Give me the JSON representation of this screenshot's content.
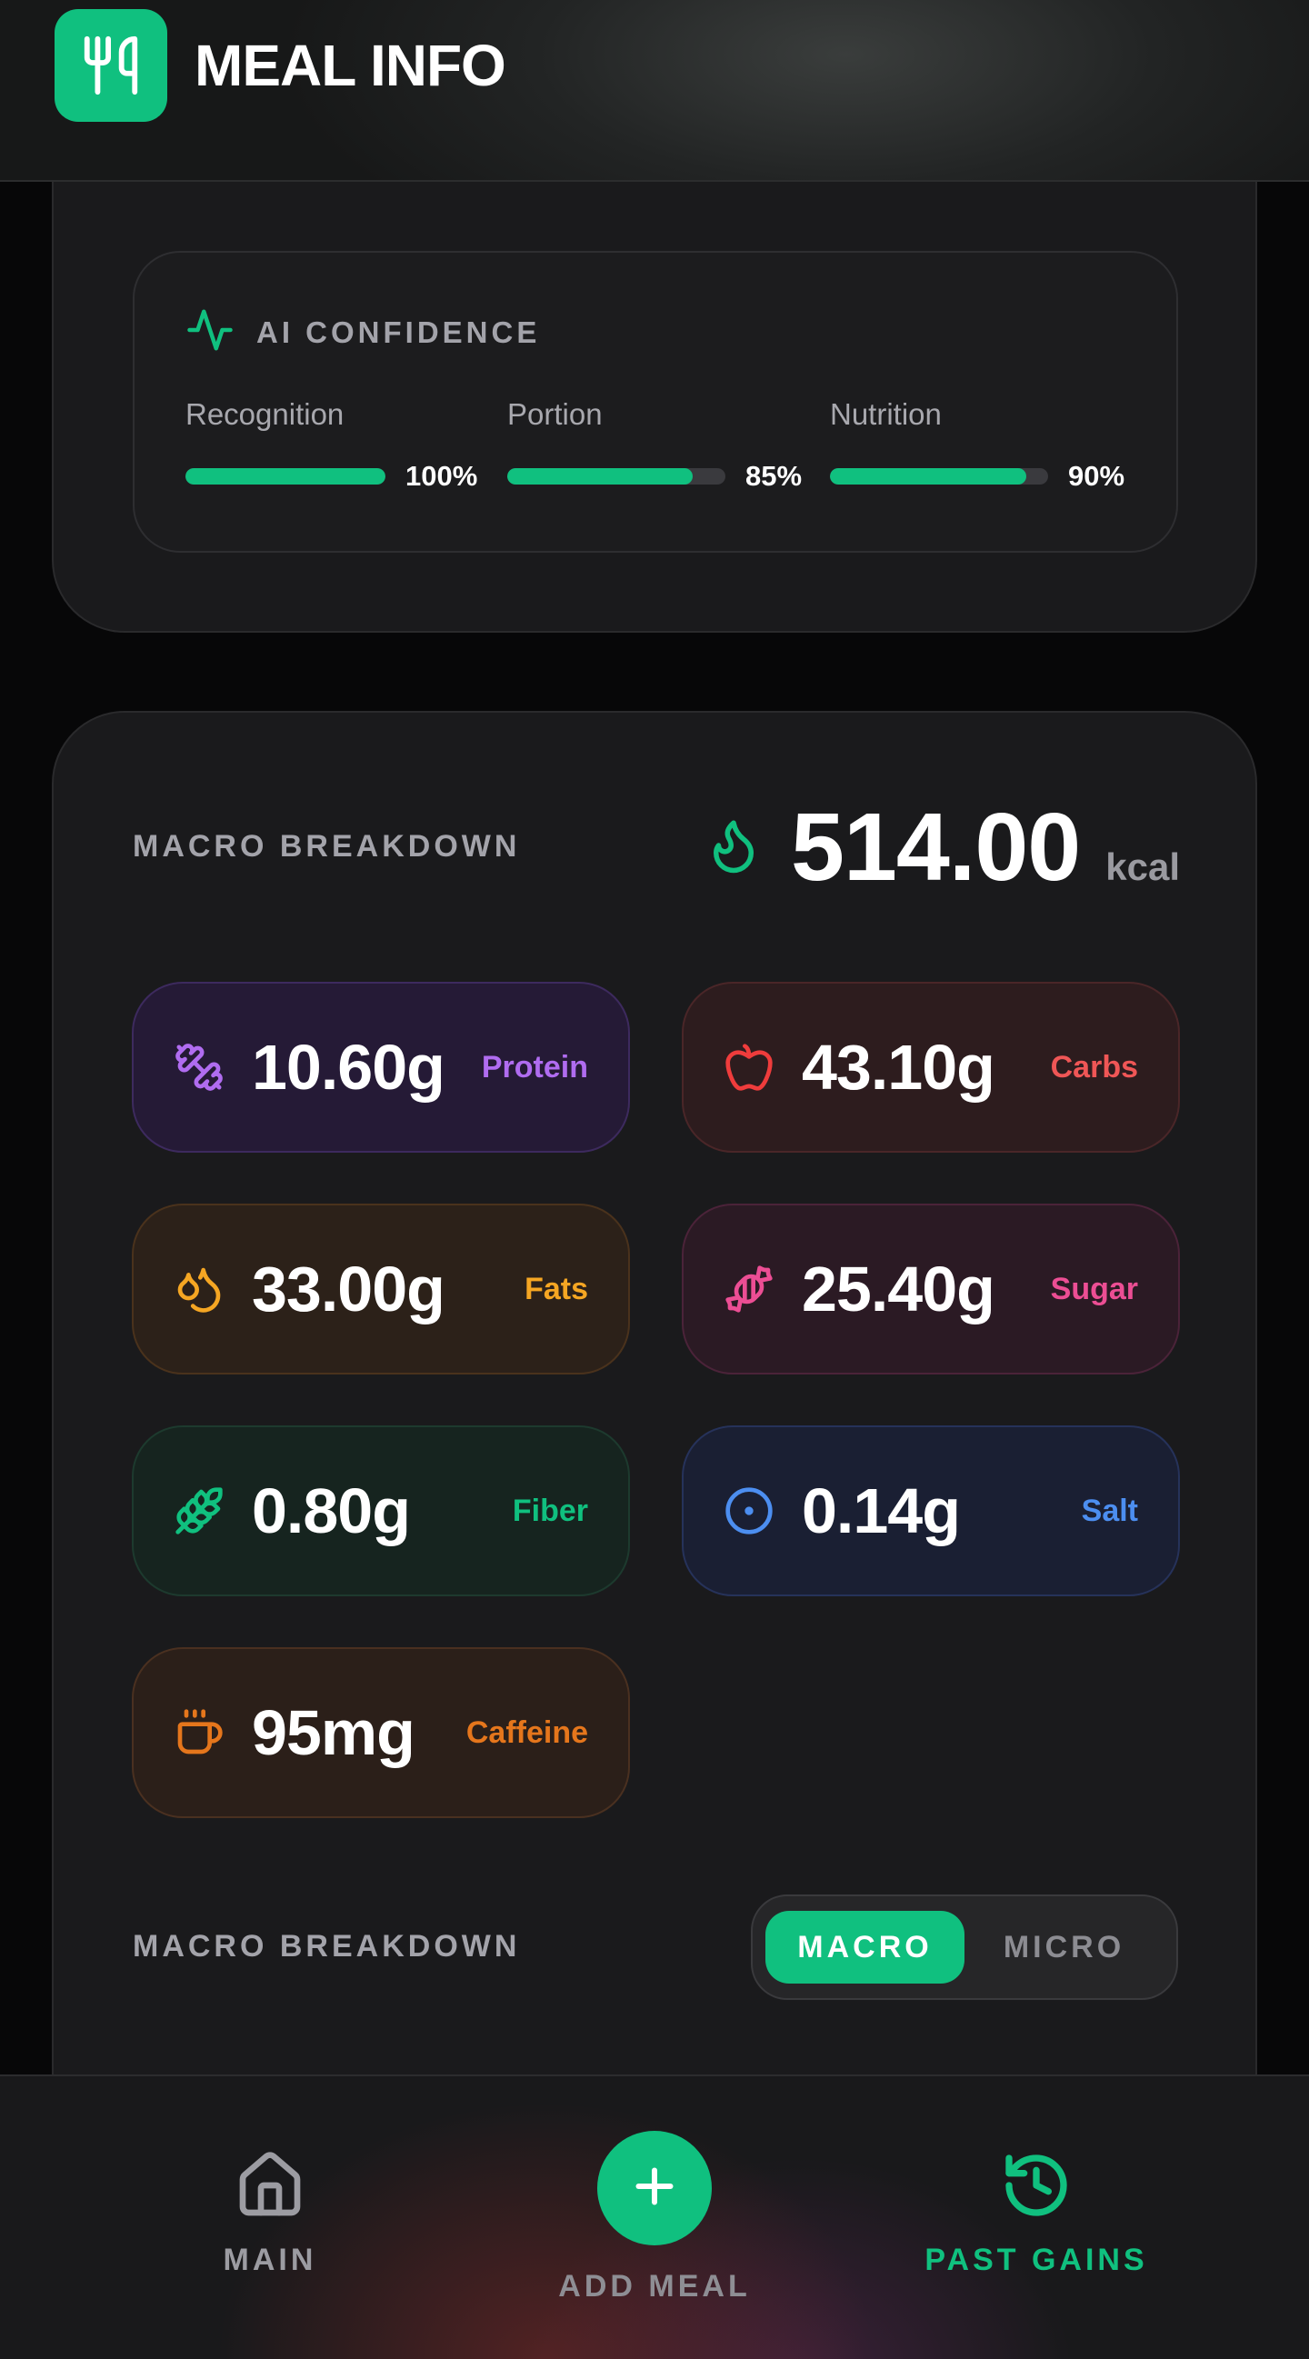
{
  "header": {
    "title": "MEAL INFO"
  },
  "ai_confidence": {
    "title": "AI CONFIDENCE",
    "metrics": [
      {
        "label": "Recognition",
        "value": "100%",
        "level": 1.0
      },
      {
        "label": "Portion",
        "value": "85%",
        "level": 0.85
      },
      {
        "label": "Nutrition",
        "value": "90%",
        "level": 0.9
      }
    ]
  },
  "macro": {
    "title": "MACRO BREAKDOWN",
    "kcal_value": "514.00",
    "kcal_unit": "kcal",
    "nutrients": [
      {
        "name": "protein",
        "value": "10.60g",
        "label": "Protein",
        "color": "#b06cf0",
        "icon": "dumbbell-icon"
      },
      {
        "name": "carbs",
        "value": "43.10g",
        "label": "Carbs",
        "color": "#ef5656",
        "icon": "apple-icon"
      },
      {
        "name": "fats",
        "value": "33.00g",
        "label": "Fats",
        "color": "#f5a623",
        "icon": "droplets-icon"
      },
      {
        "name": "sugar",
        "value": "25.40g",
        "label": "Sugar",
        "color": "#ec4e94",
        "icon": "candy-icon"
      },
      {
        "name": "fiber",
        "value": "0.80g",
        "label": "Fiber",
        "color": "#10c07f",
        "icon": "wheat-icon"
      },
      {
        "name": "salt",
        "value": "0.14g",
        "label": "Salt",
        "color": "#4c8ef0",
        "icon": "target-icon"
      },
      {
        "name": "caffeine",
        "value": "95mg",
        "label": "Caffeine",
        "color": "#e5761c",
        "icon": "coffee-icon"
      }
    ],
    "breakdown_title": "MACRO BREAKDOWN",
    "toggle": {
      "active": "MACRO",
      "inactive": "MICRO"
    }
  },
  "nav": {
    "main": "MAIN",
    "add_meal": "ADD MEAL",
    "past_gains": "PAST GAINS"
  },
  "colors": {
    "accent": "#10c07f",
    "background": "#070708",
    "card": "#1a1a1c"
  }
}
